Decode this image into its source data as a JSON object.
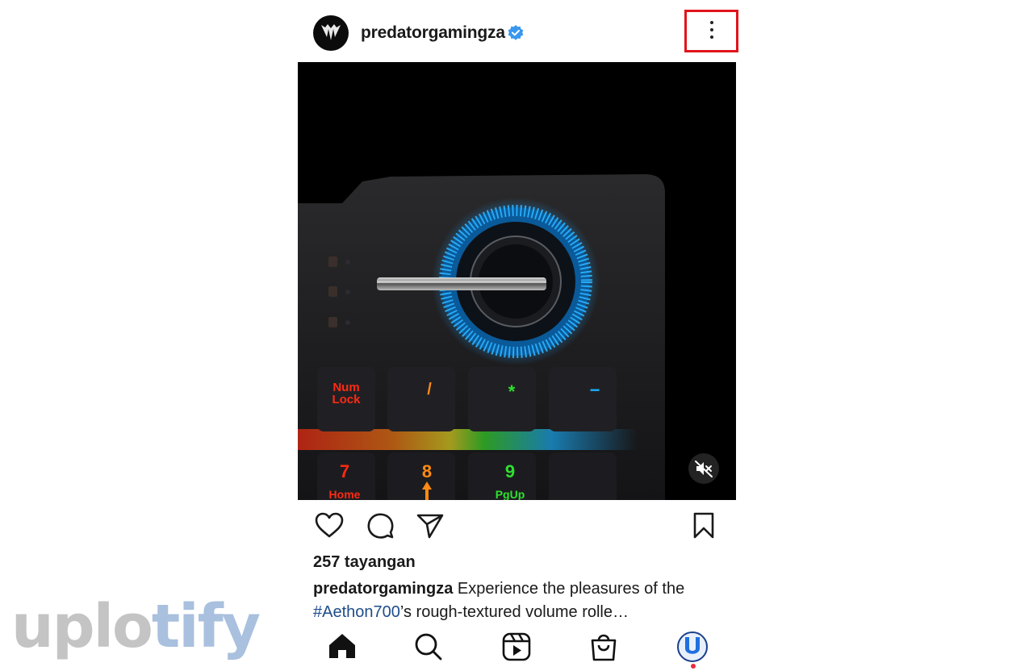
{
  "post": {
    "username": "predatorgamingza",
    "views": "257 tayangan",
    "caption": {
      "username": "predatorgamingza",
      "text_before": " Experience the pleasures of the ",
      "hashtag": "#Aethon700",
      "text_after": "’s rough-textured volume rolle…"
    },
    "media_keys": {
      "numlock_line1": "Num",
      "numlock_line2": "Lock",
      "slash": "/",
      "asterisk": "*",
      "minus": "−",
      "seven": "7",
      "home": "Home",
      "eight": "8",
      "nine": "9",
      "pgup": "PgUp"
    }
  },
  "icons": {
    "avatar": "predator-logo-icon",
    "verified": "verified-badge-icon",
    "more": "more-options-icon",
    "mute": "muted-speaker-icon",
    "like": "heart-icon",
    "comment": "comment-icon",
    "share": "send-icon",
    "save": "bookmark-icon",
    "nav": [
      "home-icon",
      "search-icon",
      "reels-icon",
      "shop-icon",
      "profile-icon"
    ]
  },
  "watermark": {
    "part1": "uplo",
    "part2": "tify"
  },
  "colors": {
    "highlight": "#e0141b",
    "verified": "#3897f0",
    "hashtag": "#1e4d8c",
    "notification": "#ed2a3c",
    "ring_glow": "#1fa3ff",
    "watermark_gray": "#c4c4c4",
    "watermark_blue": "#a9c0de"
  }
}
